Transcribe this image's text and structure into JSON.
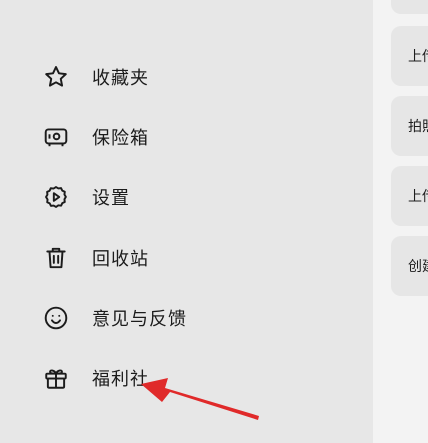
{
  "menu": {
    "items": [
      {
        "label": "收藏夹",
        "icon": "star-icon"
      },
      {
        "label": "保险箱",
        "icon": "safe-icon"
      },
      {
        "label": "设置",
        "icon": "gear-icon"
      },
      {
        "label": "回收站",
        "icon": "trash-icon"
      },
      {
        "label": "意见与反馈",
        "icon": "smiley-icon"
      },
      {
        "label": "福利社",
        "icon": "gift-icon"
      }
    ]
  },
  "right_pane": {
    "cards": [
      {
        "label": "上传"
      },
      {
        "label": "拍照"
      },
      {
        "label": "上传"
      },
      {
        "label": "创建"
      }
    ]
  },
  "annotation": {
    "arrow_color": "#e02a2a"
  }
}
